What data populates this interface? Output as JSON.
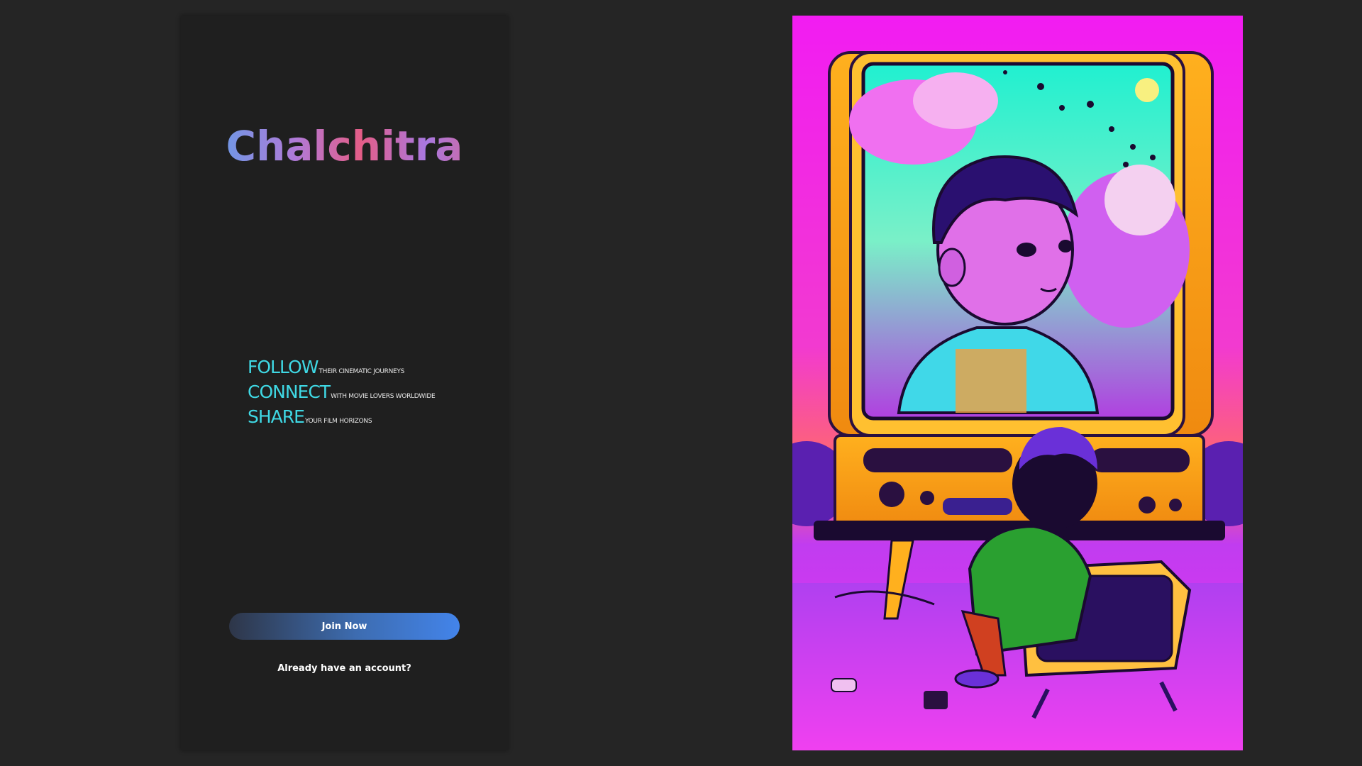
{
  "brand": {
    "name": "Chalchitra"
  },
  "taglines": [
    {
      "headline": "FOLLOW",
      "detail": "THEIR CINEMATIC JOURNEYS"
    },
    {
      "headline": "CONNECT",
      "detail": "WITH MOVIE LOVERS WORLDWIDE"
    },
    {
      "headline": "SHARE",
      "detail": "YOUR FILM HORIZONS"
    }
  ],
  "actions": {
    "join_label": "Join Now",
    "signin_label": "Already have an account?"
  },
  "colors": {
    "background": "#252525",
    "card": "#1f1f1f",
    "tagline_accent": "#3fd8e4",
    "button_gradient_start": "#2e3648",
    "button_gradient_end": "#4384ea",
    "art_background": "#f01ef0"
  },
  "illustration": {
    "subject": "child-watching-retro-tv-illustration"
  }
}
